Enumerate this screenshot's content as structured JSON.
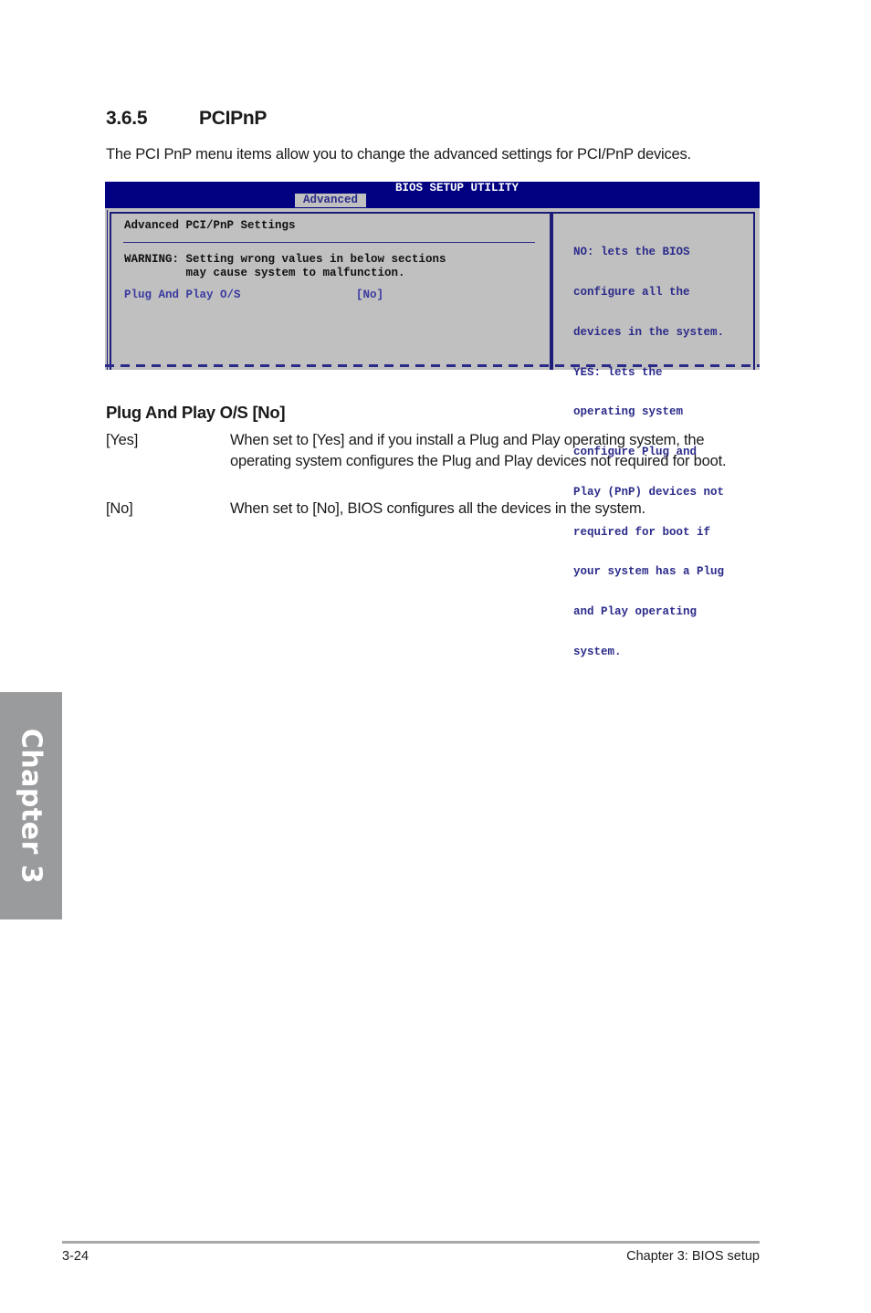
{
  "section": {
    "number": "3.6.5",
    "title": "PCIPnP",
    "intro": "The PCI PnP menu items allow you to change the advanced settings for PCI/PnP devices."
  },
  "bios": {
    "title": "BIOS SETUP UTILITY",
    "active_tab": "Advanced",
    "panel_title": "Advanced PCI/PnP Settings",
    "warning_line1": "WARNING: Setting wrong values in below sections",
    "warning_line2": "         may cause system to malfunction.",
    "items": [
      {
        "label": "Plug And Play O/S",
        "value": "[No]"
      }
    ],
    "help_lines": [
      "NO: lets the BIOS",
      "configure all the",
      "devices in the system.",
      "YES: lets the",
      "operating system",
      "configure Plug and",
      "Play (PnP) devices not",
      "required for boot if",
      "your system has a Plug",
      "and Play operating",
      "system."
    ],
    "colors": {
      "header_bg": "#000080",
      "panel_bg": "#c0c0c0",
      "item_text": "#3a3aa0"
    }
  },
  "item_detail": {
    "heading": "Plug And Play O/S [No]",
    "options": [
      {
        "key": "[Yes]",
        "desc": "When set to [Yes] and if you install a Plug and Play operating system, the operating system configures the Plug and Play devices not required for boot."
      },
      {
        "key": "[No]",
        "desc": "When set to [No], BIOS configures all the devices in the system."
      }
    ]
  },
  "side_tab": {
    "label": "Chapter 3"
  },
  "footer": {
    "page": "3-24",
    "chapter": "Chapter 3: BIOS setup"
  }
}
